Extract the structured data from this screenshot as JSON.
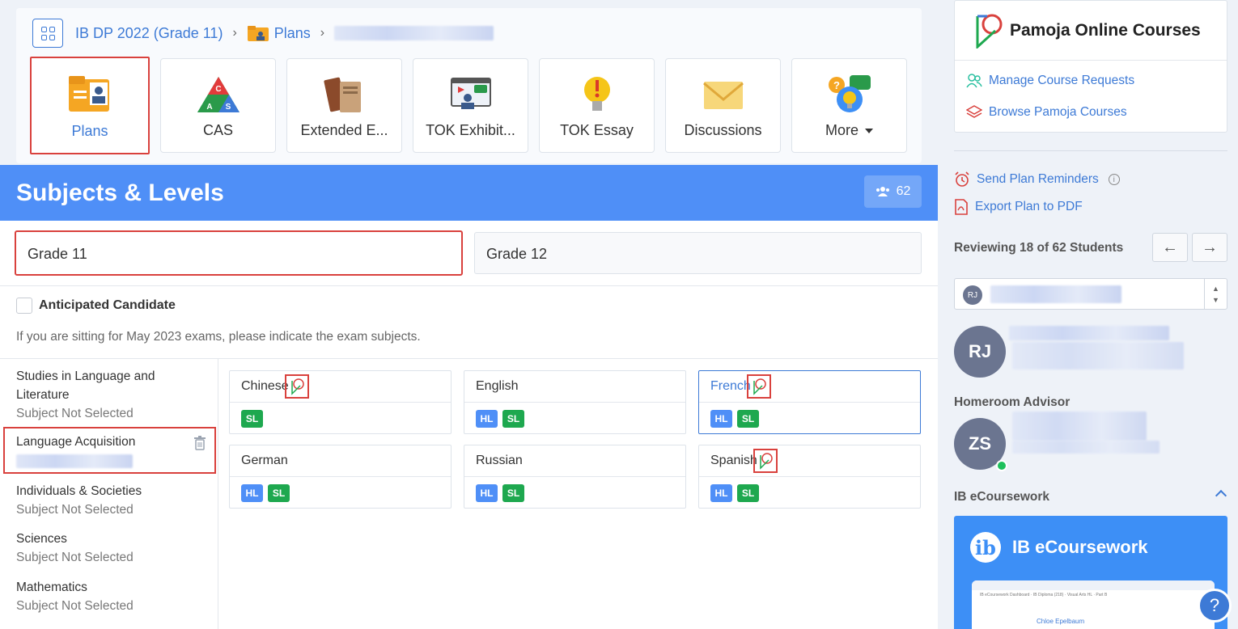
{
  "breadcrumb": {
    "program": "IB DP 2022 (Grade 11)",
    "section": "Plans"
  },
  "tiles": [
    {
      "label": "Plans",
      "icon": "plans-folder-icon"
    },
    {
      "label": "CAS",
      "icon": "cas-triangle-icon"
    },
    {
      "label": "Extended E...",
      "icon": "books-icon"
    },
    {
      "label": "TOK Exhibit...",
      "icon": "presentation-icon"
    },
    {
      "label": "TOK Essay",
      "icon": "lightbulb-icon"
    },
    {
      "label": "Discussions",
      "icon": "envelope-icon"
    },
    {
      "label": "More",
      "icon": "ideas-chat-icon"
    }
  ],
  "banner": {
    "title": "Subjects & Levels",
    "count": "62"
  },
  "grades": {
    "tab1": "Grade 11",
    "tab2": "Grade 12"
  },
  "anticipated": {
    "label": "Anticipated Candidate",
    "hint": "If you are sitting for May 2023 exams, please indicate the exam subjects."
  },
  "groups": {
    "g1_line1": "Studies in Language and",
    "g1_line2": "Literature",
    "g1_status": "Subject Not Selected",
    "g2": "Language Acquisition",
    "g3": "Individuals & Societies",
    "g3_status": "Subject Not Selected",
    "g4": "Sciences",
    "g4_status": "Subject Not Selected",
    "g5": "Mathematics",
    "g5_status": "Subject Not Selected"
  },
  "subjects": {
    "chinese": "Chinese",
    "english": "English",
    "french": "French",
    "german": "German",
    "russian": "Russian",
    "spanish": "Spanish",
    "hl": "HL",
    "sl": "SL"
  },
  "sidebar": {
    "brand": "Pamoja Online Courses",
    "manage": "Manage Course Requests",
    "browse": "Browse Pamoja Courses",
    "reminders": "Send Plan Reminders",
    "export": "Export Plan to PDF",
    "reviewing": "Reviewing 18 of 62 Students",
    "student_initials": "RJ",
    "advisor_title": "Homeroom Advisor",
    "advisor_initials": "ZS",
    "ecw_section": "IB eCoursework",
    "ecw_banner": "IB eCoursework",
    "ecw_logo": "ib",
    "ecw_shot_line": "IB eCoursework      Dashboard  ·  IB Diploma (218)  ·  Visual Arts HL  ·  Part B",
    "ecw_shot_name": "Chloe Epelbaum",
    "help": "?"
  },
  "colors": {
    "accent": "#4f8ff7",
    "link": "#3d7ad6",
    "highlight": "#d9413d",
    "hl": "#4f8ff7",
    "sl": "#1ea84f"
  }
}
